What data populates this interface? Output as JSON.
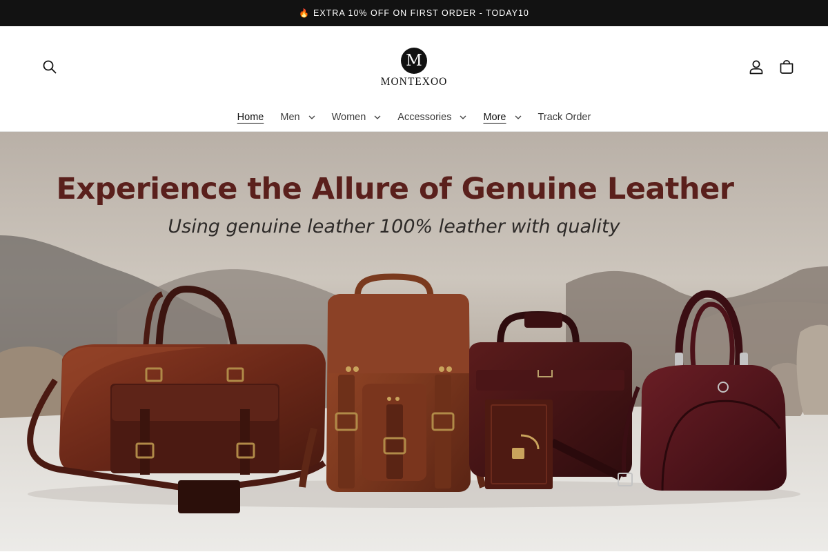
{
  "announcement": {
    "icon": "fire-icon",
    "text": "EXTRA 10% OFF ON FIRST ORDER - TODAY10"
  },
  "header": {
    "logo_monogram": "M",
    "logo_text": "MONTEXOO",
    "icons": {
      "search": "search-icon",
      "account": "user-icon",
      "cart": "shopping-bag-icon"
    }
  },
  "nav": {
    "items": [
      {
        "label": "Home",
        "active": true,
        "dropdown": false
      },
      {
        "label": "Men",
        "active": false,
        "dropdown": true
      },
      {
        "label": "Women",
        "active": false,
        "dropdown": true
      },
      {
        "label": "Accessories",
        "active": false,
        "dropdown": true
      },
      {
        "label": "More",
        "active": true,
        "dropdown": true
      },
      {
        "label": "Track Order",
        "active": false,
        "dropdown": false
      }
    ]
  },
  "hero": {
    "title": "Experience the Allure of Genuine Leather",
    "subtitle": "Using genuine leather 100% leather with quality"
  },
  "colors": {
    "announcement_bg": "#121212",
    "title": "#5a201c",
    "leather_brown": "#7a3520",
    "burgundy": "#4a1416"
  }
}
